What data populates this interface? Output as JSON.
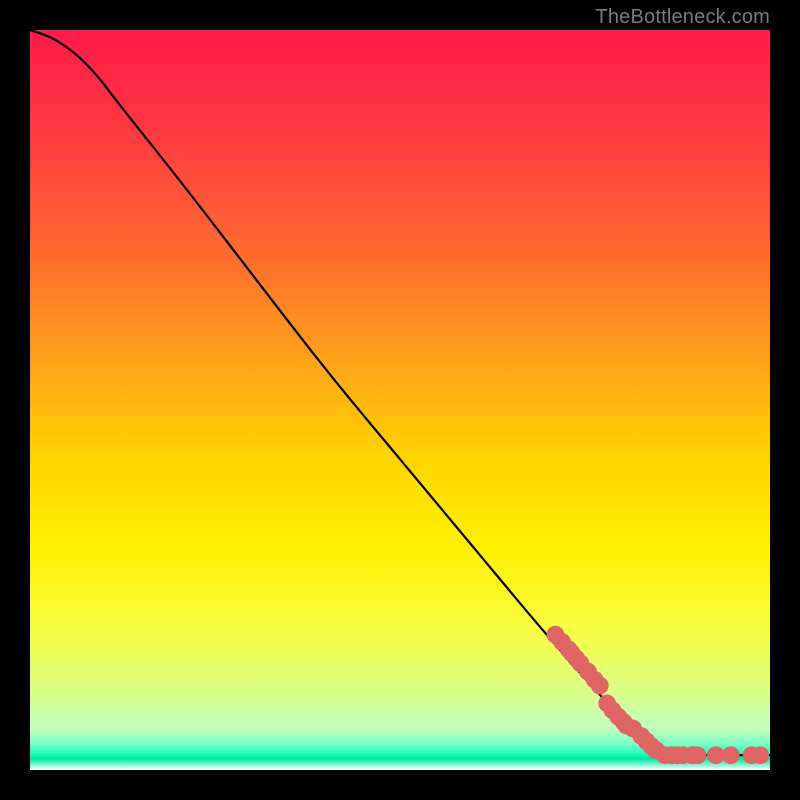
{
  "attribution": "TheBottleneck.com",
  "chart_data": {
    "type": "line",
    "title": "",
    "xlabel": "",
    "ylabel": "",
    "xlim": [
      0,
      100
    ],
    "ylim": [
      0,
      100
    ],
    "grid": false,
    "legend": false,
    "background_gradient": {
      "stops": [
        {
          "offset": 0.0,
          "color": "#ff1a4a"
        },
        {
          "offset": 0.15,
          "color": "#ff3c3f"
        },
        {
          "offset": 0.3,
          "color": "#ff6a2f"
        },
        {
          "offset": 0.45,
          "color": "#ffa41a"
        },
        {
          "offset": 0.58,
          "color": "#ffd400"
        },
        {
          "offset": 0.7,
          "color": "#fff100"
        },
        {
          "offset": 0.82,
          "color": "#f6ff4a"
        },
        {
          "offset": 0.9,
          "color": "#d8ff8c"
        },
        {
          "offset": 0.945,
          "color": "#bfffc0"
        },
        {
          "offset": 0.965,
          "color": "#7affc4"
        },
        {
          "offset": 0.975,
          "color": "#2fffc0"
        },
        {
          "offset": 0.985,
          "color": "#00e89e"
        },
        {
          "offset": 1.0,
          "color": "#ffffff"
        }
      ]
    },
    "curve": {
      "description": "Bottleneck curve: y ≈ 100 at x=0, gently convex to x≈12, then linear descent to y≈2 at x≈85, then flat at y≈2 to x=100.",
      "points_xy": [
        [
          0,
          100
        ],
        [
          3,
          99
        ],
        [
          6,
          97
        ],
        [
          9,
          94
        ],
        [
          12,
          90
        ],
        [
          20,
          80
        ],
        [
          30,
          67
        ],
        [
          40,
          54
        ],
        [
          50,
          42
        ],
        [
          60,
          30
        ],
        [
          70,
          18
        ],
        [
          78,
          9
        ],
        [
          85,
          2
        ],
        [
          90,
          2
        ],
        [
          95,
          2
        ],
        [
          100,
          2
        ]
      ]
    },
    "markers": {
      "color": "#e06666",
      "radius_frac": 0.012,
      "points_xy": [
        [
          71.0,
          18.3
        ],
        [
          71.9,
          17.3
        ],
        [
          72.8,
          16.3
        ],
        [
          73.2,
          15.8
        ],
        [
          73.8,
          15.1
        ],
        [
          74.4,
          14.4
        ],
        [
          75.4,
          13.3
        ],
        [
          76.3,
          12.2
        ],
        [
          77.0,
          11.4
        ],
        [
          78.0,
          9.0
        ],
        [
          78.7,
          8.1
        ],
        [
          79.5,
          7.2
        ],
        [
          80.2,
          6.5
        ],
        [
          80.6,
          6.0
        ],
        [
          81.5,
          5.6
        ],
        [
          82.6,
          4.6
        ],
        [
          83.3,
          3.9
        ],
        [
          84.0,
          3.2
        ],
        [
          84.6,
          2.7
        ],
        [
          85.8,
          2.0
        ],
        [
          86.7,
          2.0
        ],
        [
          87.5,
          2.0
        ],
        [
          88.2,
          2.0
        ],
        [
          89.5,
          2.0
        ],
        [
          90.2,
          2.0
        ],
        [
          92.7,
          2.0
        ],
        [
          94.7,
          2.0
        ],
        [
          97.5,
          2.0
        ],
        [
          98.7,
          2.0
        ]
      ]
    }
  }
}
